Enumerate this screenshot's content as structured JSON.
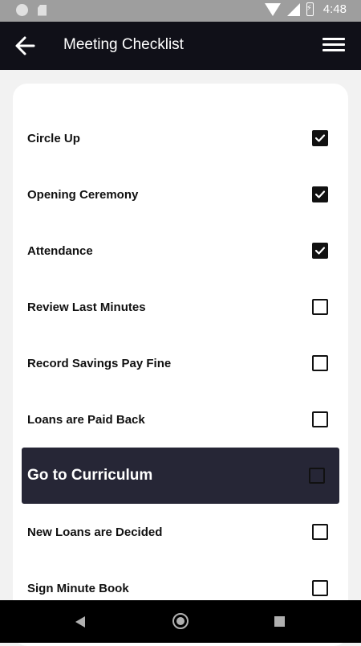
{
  "status_bar": {
    "time": "4:48"
  },
  "app_bar": {
    "title": "Meeting Checklist",
    "back_icon": "arrow-left-icon",
    "menu_icon": "hamburger-menu-icon"
  },
  "checklist": {
    "items": [
      {
        "label": "Circle Up",
        "checked": true
      },
      {
        "label": "Opening Ceremony",
        "checked": true
      },
      {
        "label": "Attendance",
        "checked": true
      },
      {
        "label": "Review Last Minutes",
        "checked": false
      },
      {
        "label": "Record Savings Pay Fine",
        "checked": false
      },
      {
        "label": "Loans are Paid Back",
        "checked": false
      },
      {
        "label": "Go to Curriculum",
        "checked": false,
        "highlighted": true
      },
      {
        "label": "New Loans are Decided",
        "checked": false
      },
      {
        "label": "Sign Minute Book",
        "checked": false
      }
    ]
  },
  "colors": {
    "app_bar": "#101018",
    "highlight_row": "#262636",
    "card": "#ffffff"
  }
}
